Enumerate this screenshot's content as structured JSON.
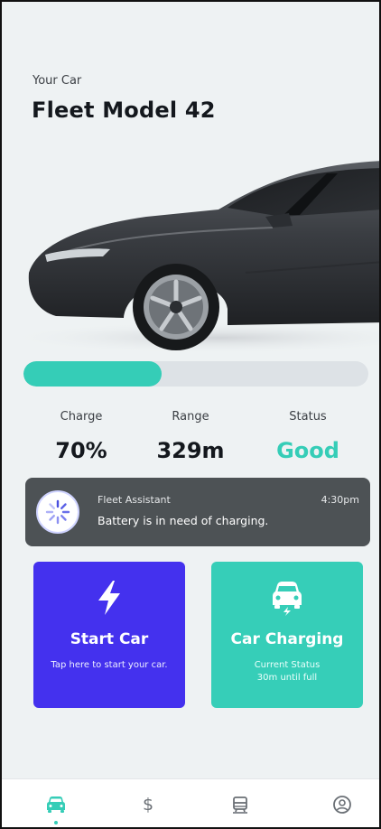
{
  "header": {
    "subtitle": "Your Car",
    "title": "Fleet Model 42"
  },
  "car": {
    "image": "car-image",
    "body_color": "#3a3d42"
  },
  "charge_bar": {
    "level_percent": 40,
    "fill_color": "#35cdb7",
    "track_color": "#dde2e6"
  },
  "stats": {
    "charge": {
      "label": "Charge",
      "value": "70%"
    },
    "range": {
      "label": "Range",
      "value": "329m"
    },
    "status": {
      "label": "Status",
      "value": "Good",
      "color": "#35cdb7"
    }
  },
  "notification": {
    "sender": "Fleet Assistant",
    "time": "4:30pm",
    "message": "Battery is in need of charging.",
    "avatar_icon": "loader-icon"
  },
  "cards": {
    "start_car": {
      "title": "Start Car",
      "subtitle": "Tap here to start your car.",
      "icon": "lightning-icon",
      "color": "#4431ee"
    },
    "car_charging": {
      "title": "Car Charging",
      "subtitle_line1": "Current Status",
      "subtitle_line2": "30m until full",
      "icon": "car-charging-icon",
      "color": "#36ceb8"
    }
  },
  "nav": {
    "items": [
      {
        "name": "car",
        "icon": "car-icon",
        "active": true
      },
      {
        "name": "billing",
        "icon": "dollar-icon",
        "active": false
      },
      {
        "name": "transit",
        "icon": "bus-icon",
        "active": false
      },
      {
        "name": "profile",
        "icon": "profile-icon",
        "active": false
      }
    ],
    "active_color": "#35cdb7"
  }
}
